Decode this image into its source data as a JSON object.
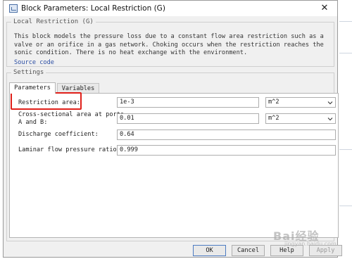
{
  "window": {
    "title": "Block Parameters: Local Restriction (G)"
  },
  "block_group": {
    "legend": "Local Restriction (G)",
    "description": "This block models the pressure loss due to a constant flow area restriction such as a valve or an orifice in a gas network. Choking occurs when the restriction reaches the sonic condition. There is no heat exchange with the environment.",
    "source_link": "Source code"
  },
  "settings_group": {
    "legend": "Settings",
    "tabs": [
      {
        "label": "Parameters",
        "active": true
      },
      {
        "label": "Variables",
        "active": false
      }
    ],
    "params": [
      {
        "label": "Restriction area:",
        "value": "1e-3",
        "unit": "m^2"
      },
      {
        "label_line1": "Cross-sectional area at ports",
        "label_line2": "A and B:",
        "value": "0.01",
        "unit": "m^2"
      },
      {
        "label": "Discharge coefficient:",
        "value": "0.64"
      },
      {
        "label": "Laminar flow pressure ratio:",
        "value": "0.999"
      }
    ]
  },
  "buttons": {
    "ok": "OK",
    "cancel": "Cancel",
    "help": "Help",
    "apply": "Apply"
  },
  "watermark": {
    "main": "Bai经验",
    "sub": "jingyan.baidu.com"
  },
  "colors": {
    "highlight": "#e0201a",
    "link": "#2b4ea3",
    "dialog_bg": "#f0f0f0"
  },
  "icons": [
    "block-params-icon",
    "close-icon",
    "chevron-down-icon"
  ]
}
